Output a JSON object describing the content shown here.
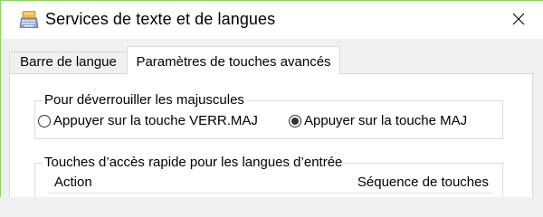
{
  "window": {
    "title": "Services de texte et de langues",
    "icon": "text-services-keyboard-icon",
    "close_icon": "close-icon"
  },
  "tabs": [
    {
      "label": "Barre de langue",
      "active": false
    },
    {
      "label": "Paramètres de touches avancés",
      "active": true
    }
  ],
  "caps_lock_group": {
    "label": "Pour déverrouiller les majuscules",
    "options": [
      {
        "label": "Appuyer sur la touche VERR.MAJ",
        "checked": false
      },
      {
        "label": "Appuyer sur la touche MAJ",
        "checked": true
      }
    ]
  },
  "hotkeys_group": {
    "label": "Touches d’accès rapide pour les langues d’entrée",
    "columns": [
      "Action",
      "Séquence de touches"
    ]
  },
  "colors": {
    "window_accent_border": "#8cd06a",
    "dialog_background": "#f0f0f0",
    "panel_background": "#ffffff"
  }
}
